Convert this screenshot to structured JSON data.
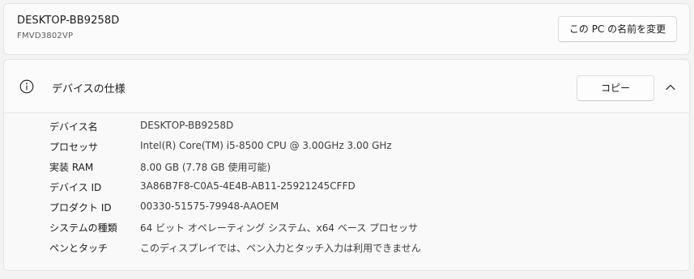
{
  "device": {
    "name": "DESKTOP-BB9258D",
    "model": "FMVD3802VP",
    "rename_button": "この PC の名前を変更"
  },
  "specs": {
    "title": "デバイスの仕様",
    "copy_button": "コピー",
    "items": [
      {
        "label": "デバイス名",
        "value": "DESKTOP-BB9258D"
      },
      {
        "label": "プロセッサ",
        "value": "Intel(R) Core(TM) i5-8500 CPU @ 3.00GHz   3.00 GHz"
      },
      {
        "label": "実装 RAM",
        "value": "8.00 GB (7.78 GB 使用可能)"
      },
      {
        "label": "デバイス ID",
        "value": "3A86B7F8-C0A5-4E4B-AB11-25921245CFFD"
      },
      {
        "label": "プロダクト ID",
        "value": "00330-51575-79948-AAOEM"
      },
      {
        "label": "システムの種類",
        "value": "64 ビット オペレーティング システム、x64 ベース プロセッサ"
      },
      {
        "label": "ペンとタッチ",
        "value": "このディスプレイでは、ペン入力とタッチ入力は利用できません"
      }
    ]
  },
  "icons": {
    "info": "info-icon",
    "chevron": "chevron-up-icon"
  }
}
